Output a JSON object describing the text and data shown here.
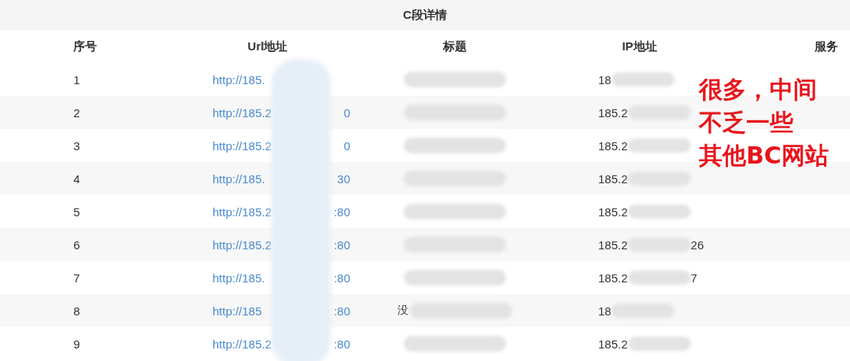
{
  "panel": {
    "title": "C段详情"
  },
  "table": {
    "columns": [
      "序号",
      "Url地址",
      "标题",
      "IP地址",
      "服务"
    ],
    "rows": [
      {
        "no": "1",
        "url_start": "http://185.",
        "url_end": "",
        "title": "",
        "ip_start": "18",
        "ip_end": ""
      },
      {
        "no": "2",
        "url_start": "http://185.2",
        "url_end": "0",
        "title": "",
        "ip_start": "185.2",
        "ip_end": ""
      },
      {
        "no": "3",
        "url_start": "http://185.2",
        "url_end": "0",
        "title": "",
        "ip_start": "185.2",
        "ip_end": ""
      },
      {
        "no": "4",
        "url_start": "http://185.",
        "url_end": "30",
        "title": "",
        "ip_start": "185.2",
        "ip_end": ""
      },
      {
        "no": "5",
        "url_start": "http://185.2",
        "url_end": ":80",
        "title": "",
        "ip_start": "185.2",
        "ip_end": ""
      },
      {
        "no": "6",
        "url_start": "http://185.2",
        "url_end": ":80",
        "title": "",
        "ip_start": "185.2",
        "ip_end": "26"
      },
      {
        "no": "7",
        "url_start": "http://185.",
        "url_end": ":80",
        "title": "",
        "ip_start": "185.2",
        "ip_end": "7"
      },
      {
        "no": "8",
        "url_start": "http://185",
        "url_end": ":80",
        "title": "没",
        "ip_start": "18",
        "ip_end": ""
      },
      {
        "no": "9",
        "url_start": "http://185.2",
        "url_end": ":80",
        "title": "",
        "ip_start": "185.2",
        "ip_end": ""
      }
    ]
  },
  "annotation": {
    "lines": [
      "很多，中间",
      "不乏一些",
      "其他BC网站"
    ]
  }
}
